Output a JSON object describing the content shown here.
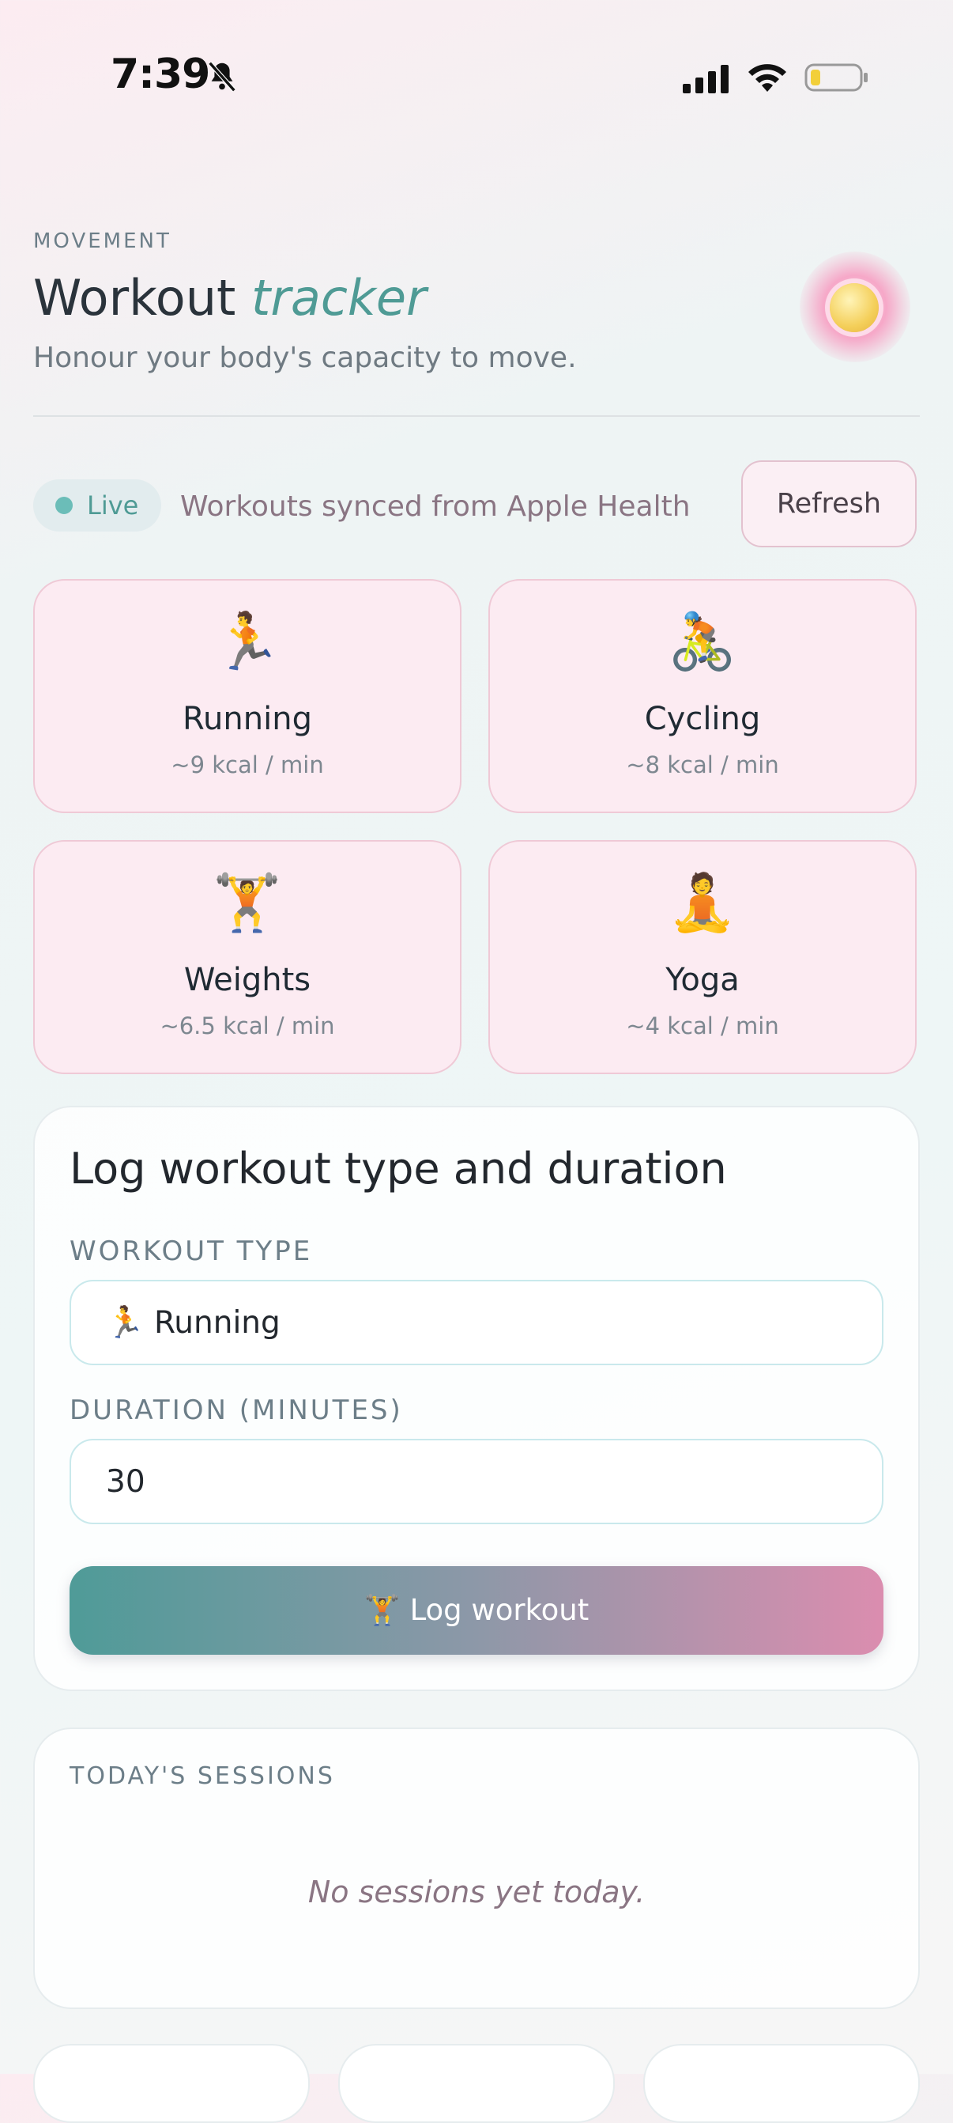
{
  "status_bar": {
    "time": "7:39",
    "icons": [
      "bell-slash-icon",
      "cellular-signal-icon",
      "wifi-icon",
      "battery-low-icon"
    ]
  },
  "header": {
    "eyebrow": "MOVEMENT",
    "title_plain": "Workout",
    "title_accent": "tracker",
    "subtitle": "Honour your body's capacity to move."
  },
  "sync": {
    "live_label": "Live",
    "message": "Workouts synced from Apple Health",
    "refresh_label": "Refresh"
  },
  "workouts": [
    {
      "emoji": "🏃",
      "name": "Running",
      "rate": "~9 kcal / min"
    },
    {
      "emoji": "🚴",
      "name": "Cycling",
      "rate": "~8 kcal / min"
    },
    {
      "emoji": "🏋️",
      "name": "Weights",
      "rate": "~6.5 kcal / min"
    },
    {
      "emoji": "🧘",
      "name": "Yoga",
      "rate": "~4 kcal / min"
    }
  ],
  "log_form": {
    "title": "Log workout type and duration",
    "type_label": "WORKOUT TYPE",
    "type_value": "🏃 Running",
    "duration_label": "DURATION (MINUTES)",
    "duration_value": "30",
    "submit_label": "🏋️ Log workout"
  },
  "sessions": {
    "label": "TODAY'S SESSIONS",
    "empty_text": "No sessions yet today."
  },
  "colors": {
    "accent_teal": "#4f9b95",
    "accent_pink": "#db8daf",
    "card_bg": "#fcebf2"
  }
}
